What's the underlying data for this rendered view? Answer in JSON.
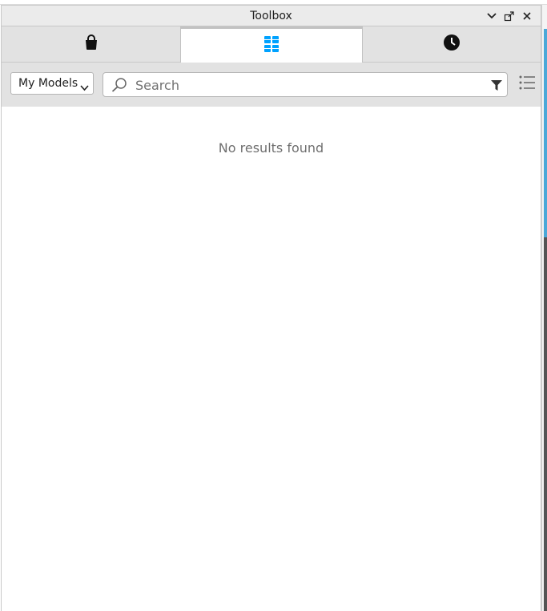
{
  "window": {
    "title": "Toolbox",
    "controls": [
      "chevron-down-icon",
      "undock-icon",
      "close-icon"
    ]
  },
  "tabs": [
    {
      "icon": "marketplace-bag-icon",
      "active": false
    },
    {
      "icon": "inventory-grid-icon",
      "active": true
    },
    {
      "icon": "recent-clock-icon",
      "active": false
    }
  ],
  "toolbar": {
    "category_selected": "My Models",
    "search_placeholder": "Search",
    "search_value": ""
  },
  "results": {
    "empty_message": "No results found"
  },
  "colors": {
    "accent": "#00a2ff",
    "panel_bg": "#e2e2e2",
    "content_bg": "#ffffff"
  }
}
